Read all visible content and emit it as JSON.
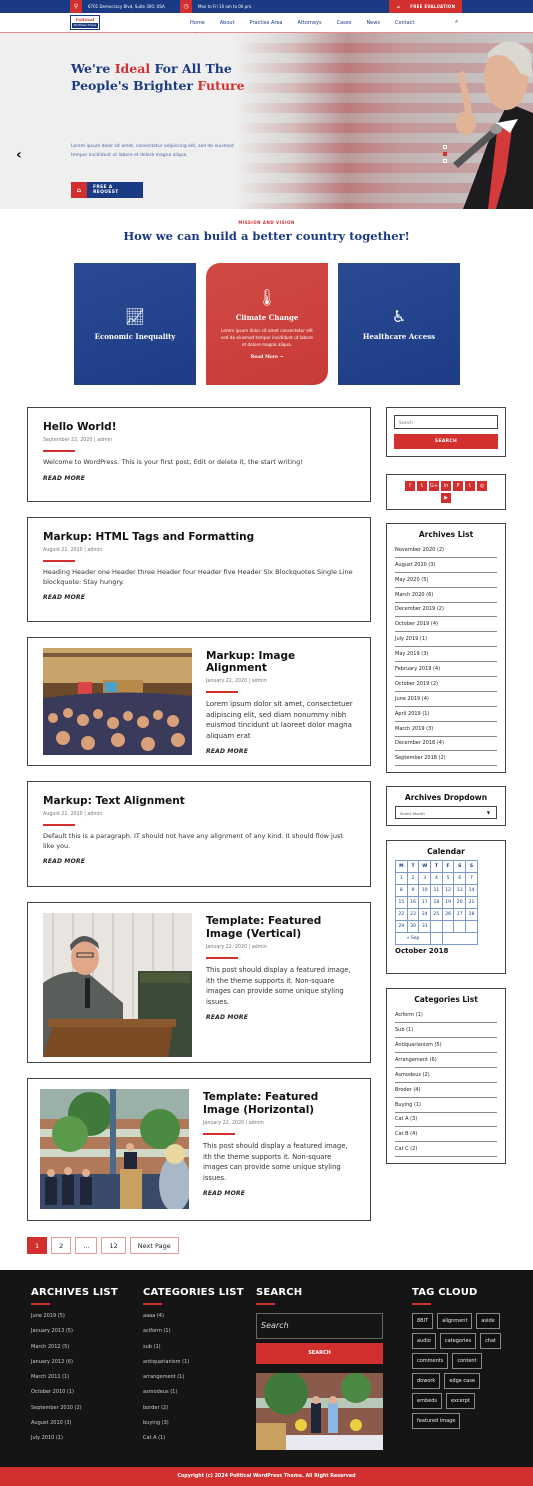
{
  "topbar": {
    "address": "6701 Democracy Blvd, Suite 300, USA",
    "hours": "Mon to Fri 10 am to 06 pm.",
    "cta": "FREE EVALUATION",
    "icons": {
      "address": "map-pin-icon",
      "hours": "clock-icon",
      "cta": "bank-icon"
    }
  },
  "logo": {
    "title": "Political",
    "subtitle": "WordPress Theme"
  },
  "nav": {
    "items": [
      "Home",
      "About",
      "Practise Area",
      "Attorneys",
      "Cases",
      "News",
      "Contact"
    ],
    "active": "Home"
  },
  "hero": {
    "title_part1": "We're ",
    "title_red1": "Ideal",
    "title_part2": " For All The People's Brighter ",
    "title_red2": "Future",
    "text": "Lorem ipsum dolor sit amet, consectetur adipiscing elit, sed do eiusmod tempor incididunt ut labore et dolore magna aliqua",
    "button": "FREE A REQUEST",
    "prev": "‹",
    "next": "›"
  },
  "mission": {
    "kicker": "MISSION AND VISION",
    "title": "How we can build a better country together!",
    "cards": [
      {
        "title": "Economic Inequality",
        "icon": "chart-line-icon"
      },
      {
        "title": "Climate Change",
        "icon": "thermometer-icon",
        "text": "Lorem ipsum dolor sit amet consectetur elit sed do eiusmod tempor incididunt ut labore et dolore magna aliqua.",
        "link": "Read More →"
      },
      {
        "title": "Healthcare Access",
        "icon": "wheelchair-icon"
      }
    ]
  },
  "posts": [
    {
      "title": "Hello World!",
      "meta": "September 22, 2020 | admin",
      "excerpt": "Welcome to WordPress. This is your first post, Edit or delete it, the start writing!",
      "read_more": "READ MORE"
    },
    {
      "title": "Markup: HTML Tags and Formatting",
      "meta": "August 22, 2020 | admin",
      "excerpt": "Heading Header one Header three Header four Header five Header Six Blockquotes Single Line blockquote: Stay hungry.",
      "read_more": "READ MORE"
    },
    {
      "title": "Markup: Image Alignment",
      "meta": "January 22, 2020 | admin",
      "excerpt": "Lorem ipsum dolor sit amet, consectetuer adipiscing elit, sed diam nonummy nibh euismod tincidunt ut laoreet dolor magna aliquam erat",
      "read_more": "READ MORE"
    },
    {
      "title": "Markup: Text Alignment",
      "meta": "August 22, 2020 | admin",
      "excerpt": "Default this is a paragraph. IT should not have any alignment of any kind. It should flow just like you.",
      "read_more": "READ MORE"
    },
    {
      "title": "Template: Featured Image (Vertical)",
      "meta": "January 22, 2020 | admin",
      "excerpt": "This post should display a featured image, ith the theme supports it. Non-square images can provide some unique styling issues.",
      "read_more": "READ MORE"
    },
    {
      "title": "Template: Featured Image (Horizontal)",
      "meta": "January 22, 2020 | admin",
      "excerpt": "This post should display a featured image, ith the theme supports it. Non-square images can provide some unique styling issues.",
      "read_more": "READ MORE"
    }
  ],
  "pagination": {
    "pages": [
      "1",
      "2",
      "...",
      "12"
    ],
    "current": "1",
    "next": "Next Page"
  },
  "sidebar": {
    "search": {
      "placeholder": "Search",
      "button": "SEARCH"
    },
    "social": [
      "f",
      "t",
      "G+",
      "in",
      "P",
      "t",
      "◎",
      "▶"
    ],
    "archives": {
      "title": "Archives List",
      "items": [
        "November 2020 (2)",
        "August 2020 (3)",
        "May 2020 (5)",
        "March 2020 (6)",
        "December 2019 (2)",
        "October 2019 (4)",
        "July 2019 (1)",
        "May 2019 (3)",
        "February 2019 (4)",
        "October 2019 (2)",
        "June 2019 (4)",
        "April 2019 (1)",
        "March 2019 (3)",
        "December 2018 (4)",
        "September 2018 (2)"
      ]
    },
    "archives_dropdown": {
      "title": "Archives Dropdown",
      "value": "Select Month"
    },
    "calendar": {
      "title": "Calendar",
      "headers": [
        "M",
        "T",
        "W",
        "T",
        "F",
        "S",
        "S"
      ],
      "rows": [
        [
          "1",
          "2",
          "3",
          "4",
          "5",
          "6",
          "7"
        ],
        [
          "8",
          "9",
          "10",
          "11",
          "12",
          "13",
          "14"
        ],
        [
          "15",
          "16",
          "17",
          "18",
          "19",
          "20",
          "21"
        ],
        [
          "22",
          "23",
          "24",
          "25",
          "26",
          "27",
          "28"
        ],
        [
          "29",
          "30",
          "31",
          "",
          "",
          "",
          ""
        ]
      ],
      "prev": "« Sep",
      "month": "October 2018"
    },
    "categories": {
      "title": "Categories List",
      "items": [
        "Aciform (1)",
        "Sub (1)",
        "Antiquarianism (5)",
        "Arrangement (6)",
        "Asmodeus (2)",
        "Broder (4)",
        "Buying (1)",
        "Cat A (3)",
        "Cat B (4)",
        "Cat C (2)"
      ]
    }
  },
  "footer": {
    "archives": {
      "title": "ARCHIVES LIST",
      "items": [
        "June 2019 (5)",
        "January  2013 (5)",
        "March 2012 (5)",
        "January  2012 (6)",
        "March  2011 (1)",
        "October 2010 (1)",
        "September 2010 (2)",
        "August 2010 (3)",
        "July 2010 (1)"
      ]
    },
    "categories": {
      "title": "CATEGORIES LIST",
      "items": [
        "aaaa (4)",
        "aciform (1)",
        "sub (1)",
        "antiquarianism (1)",
        "arrangement (1)",
        "asmodeus (1)",
        "border (2)",
        "buying (3)",
        "Cat A (1)"
      ]
    },
    "search": {
      "title": "SEARCH",
      "placeholder": "Search",
      "button": "SEARCH"
    },
    "tags": {
      "title": "TAG CLOUD",
      "items": [
        "8BIT",
        "alignment",
        "aside",
        "audio",
        "categories",
        "chat",
        "comments",
        "content",
        "dowork",
        "edge case",
        "embeds",
        "excerpt",
        "featured image"
      ]
    },
    "copyright": "Copyright (c) 2024 Political WordPress Theme. All Right Reserved"
  },
  "colors": {
    "primary_blue": "#1a3a84",
    "accent_red": "#d2302e",
    "footer_bg": "#151515"
  }
}
